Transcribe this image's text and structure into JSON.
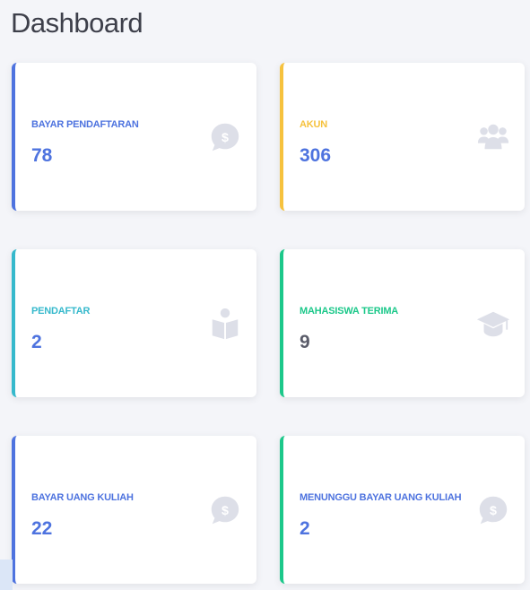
{
  "page": {
    "title": "Dashboard"
  },
  "cards": [
    {
      "label": "BAYAR PENDAFTARAN",
      "value": "78",
      "icon": "dollar-chat-icon",
      "accent": "#4e73df",
      "label_color": "#4e73df",
      "value_color": "#4e73df"
    },
    {
      "label": "AKUN",
      "value": "306",
      "icon": "users-icon",
      "accent": "#f6c23e",
      "label_color": "#f6c23e",
      "value_color": "#4e73df"
    },
    {
      "label": "PENDAFTAR",
      "value": "2",
      "icon": "person-book-icon",
      "accent": "#36b9cc",
      "label_color": "#36b9cc",
      "value_color": "#4e73df"
    },
    {
      "label": "MAHASISWA TERIMA",
      "value": "9",
      "icon": "graduation-cap-icon",
      "accent": "#1cc88a",
      "label_color": "#1cc88a",
      "value_color": "#5a5c69"
    },
    {
      "label": "BAYAR UANG KULIAH",
      "value": "22",
      "icon": "dollar-chat-icon",
      "accent": "#4e73df",
      "label_color": "#4e73df",
      "value_color": "#4e73df"
    },
    {
      "label": "MENUNGGU BAYAR UANG KULIAH",
      "value": "2",
      "icon": "dollar-chat-icon",
      "accent": "#1cc88a",
      "label_color": "#4e73df",
      "value_color": "#4e73df"
    }
  ]
}
